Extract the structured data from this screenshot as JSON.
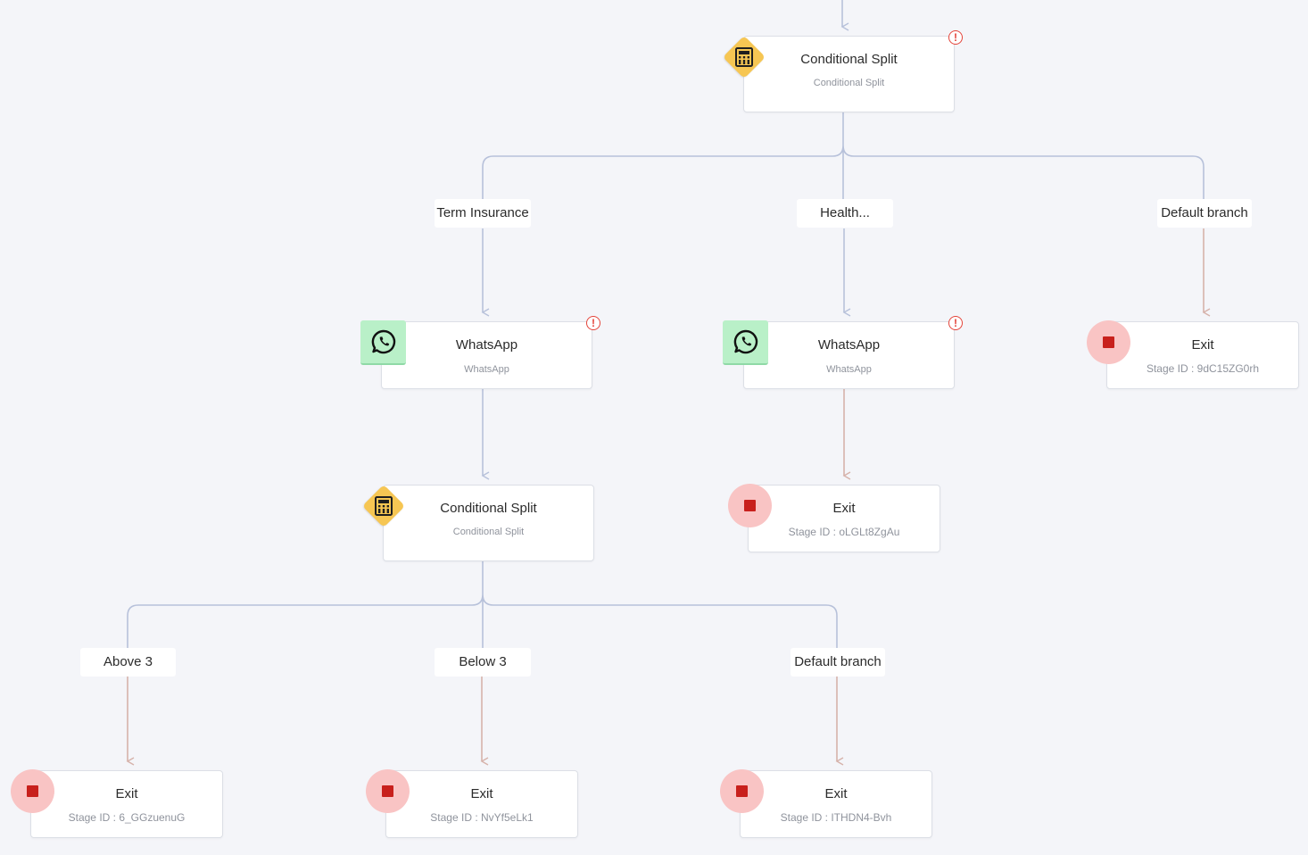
{
  "nodes": {
    "split_top": {
      "title": "Conditional Split",
      "subtitle": "Conditional Split",
      "icon": "calculator-icon"
    },
    "wa_term": {
      "title": "WhatsApp",
      "subtitle": "WhatsApp",
      "icon": "whatsapp-icon"
    },
    "wa_health": {
      "title": "WhatsApp",
      "subtitle": "WhatsApp",
      "icon": "whatsapp-icon"
    },
    "exit_default_top": {
      "title": "Exit",
      "subtitle": "Stage ID : 9dC15ZG0rh",
      "icon": "stop-icon"
    },
    "split_term": {
      "title": "Conditional Split",
      "subtitle": "Conditional Split",
      "icon": "calculator-icon"
    },
    "exit_health": {
      "title": "Exit",
      "subtitle": "Stage ID : oLGLt8ZgAu",
      "icon": "stop-icon"
    },
    "exit_above3": {
      "title": "Exit",
      "subtitle": "Stage ID : 6_GGzuenuG",
      "icon": "stop-icon"
    },
    "exit_below3": {
      "title": "Exit",
      "subtitle": "Stage ID : NvYf5eLk1",
      "icon": "stop-icon"
    },
    "exit_default_bottom": {
      "title": "Exit",
      "subtitle": "Stage ID : ITHDN4-Bvh",
      "icon": "stop-icon"
    }
  },
  "branches": {
    "term_insurance": "Term Insurance",
    "health": "Health...",
    "default_top": "Default branch",
    "above3": "Above 3",
    "below3": "Below 3",
    "default_bottom": "Default branch"
  },
  "warning_glyph": "!",
  "colors": {
    "connector": "#b7c1da",
    "exit_connector": "#d6b2aa",
    "split_icon_bg": "#f6c653",
    "whatsapp_icon_bg": "#b9f0c8",
    "exit_icon_bg": "#f9c4c4",
    "exit_icon_square": "#c8201c",
    "warning": "#e4443a"
  }
}
